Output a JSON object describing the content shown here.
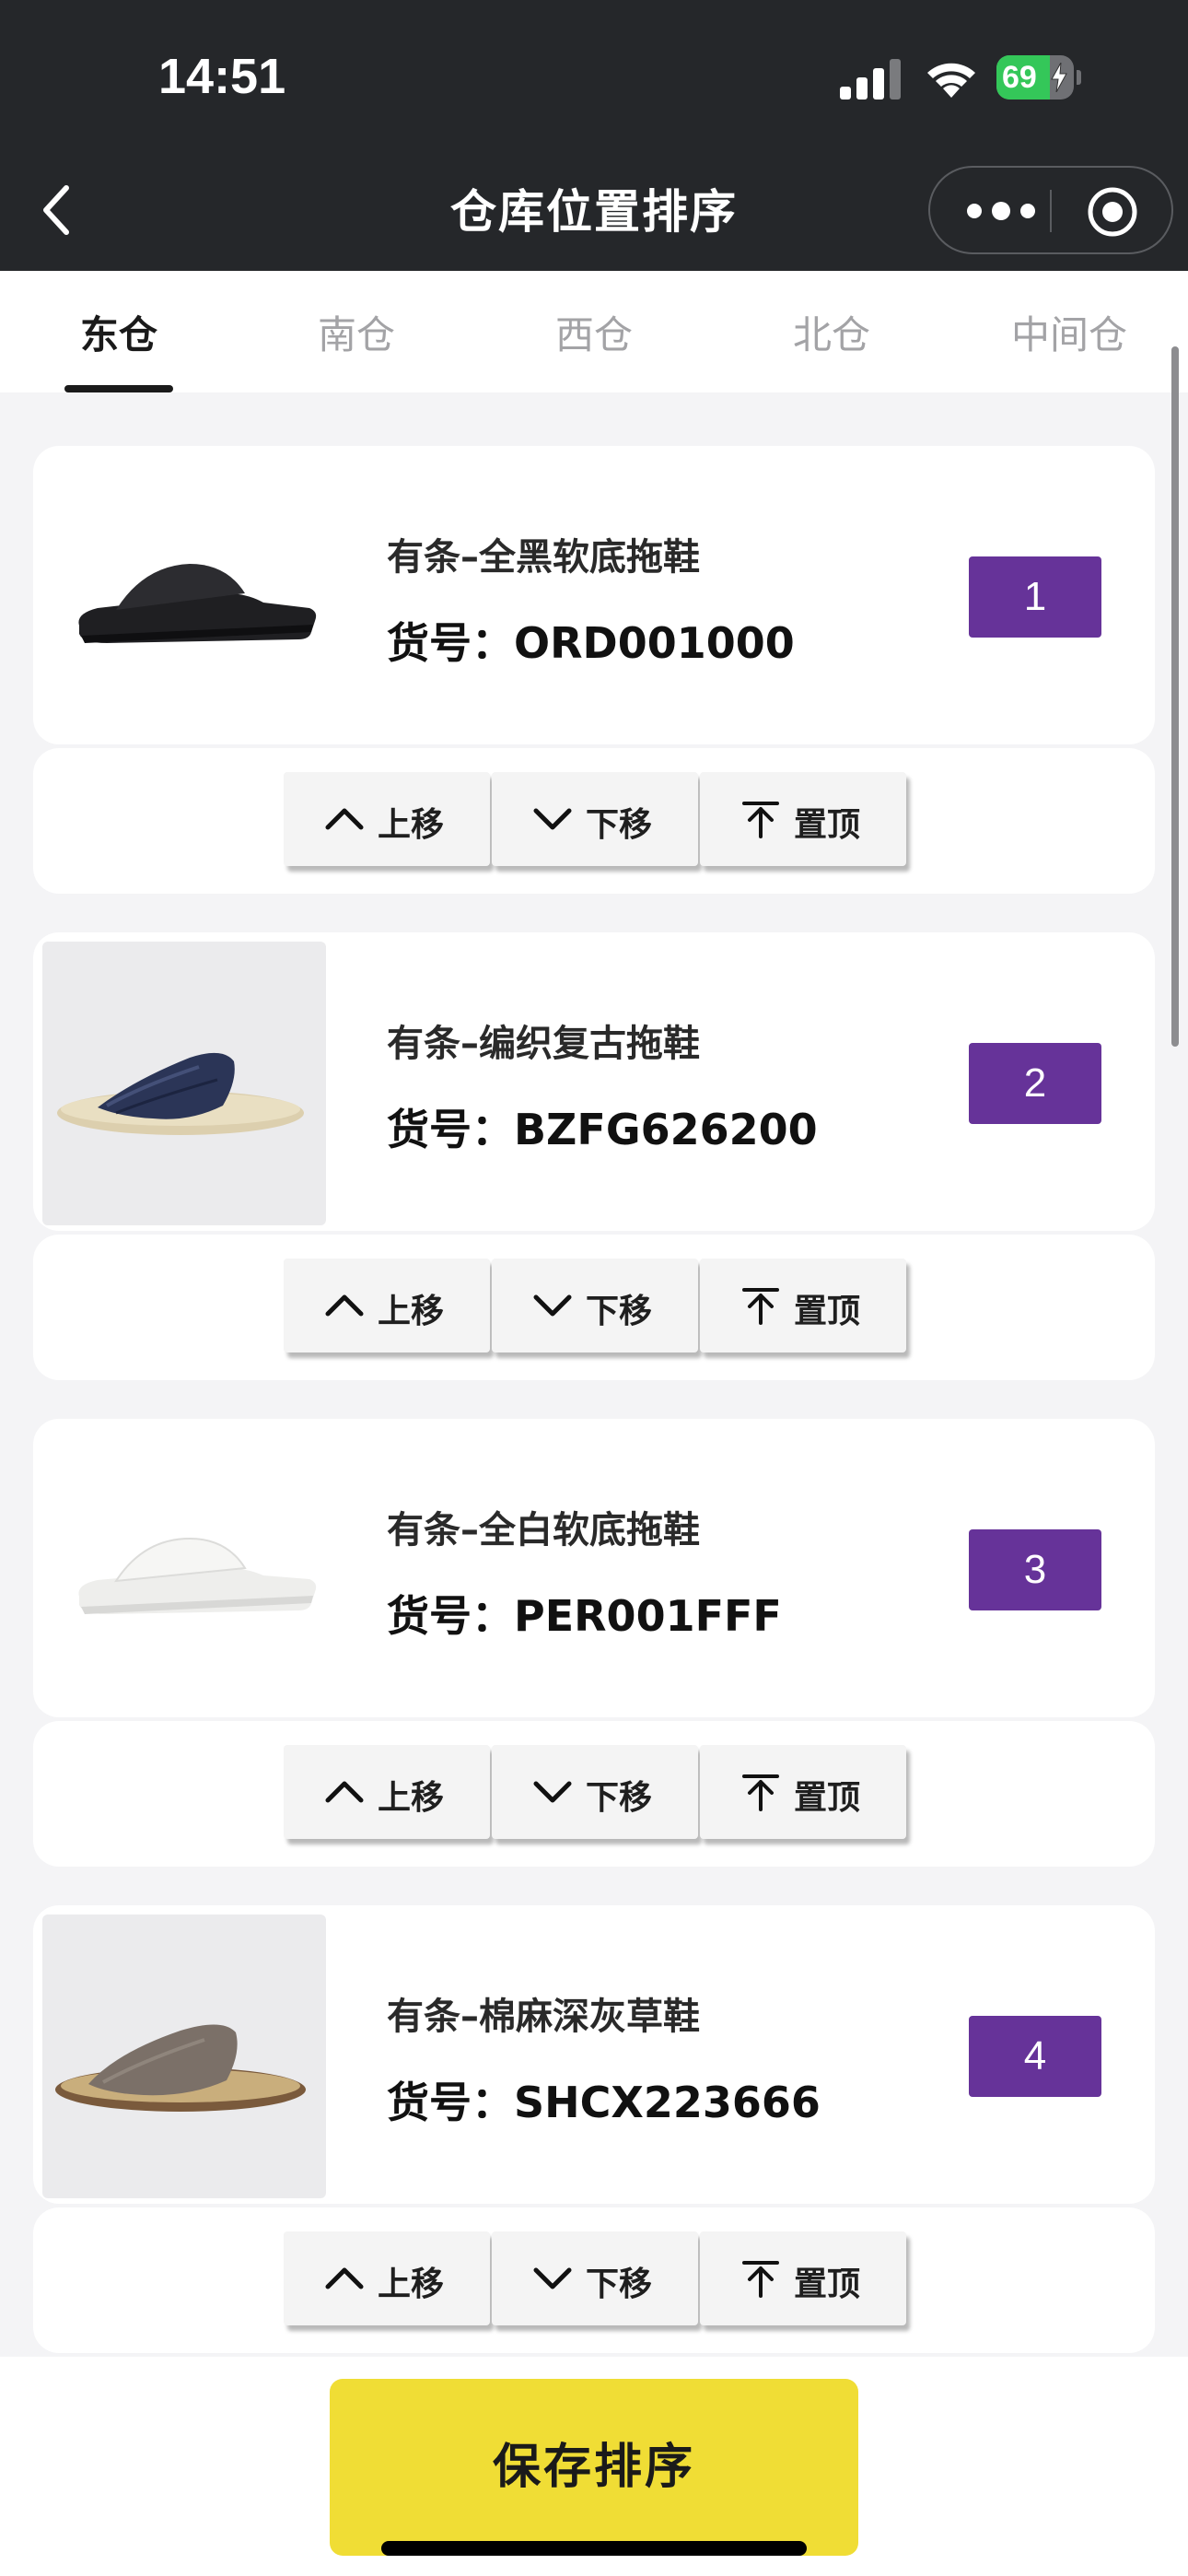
{
  "status_bar": {
    "time": "14:51",
    "battery": "69",
    "battery_level_pct": 69,
    "icons": [
      "signal-icon",
      "wifi-icon",
      "battery-charging-icon"
    ]
  },
  "nav": {
    "title": "仓库位置排序",
    "back_icon": "chevron-left-icon",
    "more_icon": "more-dots-icon",
    "target_icon": "target-circle-icon"
  },
  "tabs": [
    {
      "label": "东仓",
      "active": true
    },
    {
      "label": "南仓",
      "active": false
    },
    {
      "label": "西仓",
      "active": false
    },
    {
      "label": "北仓",
      "active": false
    },
    {
      "label": "中间仓",
      "active": false
    }
  ],
  "sku_prefix": "货号：",
  "actions": {
    "up_label": "上移",
    "down_label": "下移",
    "top_label": "置顶",
    "up_icon": "chevron-up-icon",
    "down_icon": "chevron-down-icon",
    "top_icon": "pin-to-top-icon"
  },
  "products": [
    {
      "name": "有条–全黑软底拖鞋",
      "sku": "ORD001000",
      "rank": "1"
    },
    {
      "name": "有条–编织复古拖鞋",
      "sku": "BZFG626200",
      "rank": "2"
    },
    {
      "name": "有条–全白软底拖鞋",
      "sku": "PER001FFF",
      "rank": "3"
    },
    {
      "name": "有条–棉麻深灰草鞋",
      "sku": "SHCX223666",
      "rank": "4"
    }
  ],
  "colors": {
    "header_bg": "#25272a",
    "badge": "#663399",
    "save_button": "#f0dd35"
  },
  "save_button": {
    "label": "保存排序"
  }
}
